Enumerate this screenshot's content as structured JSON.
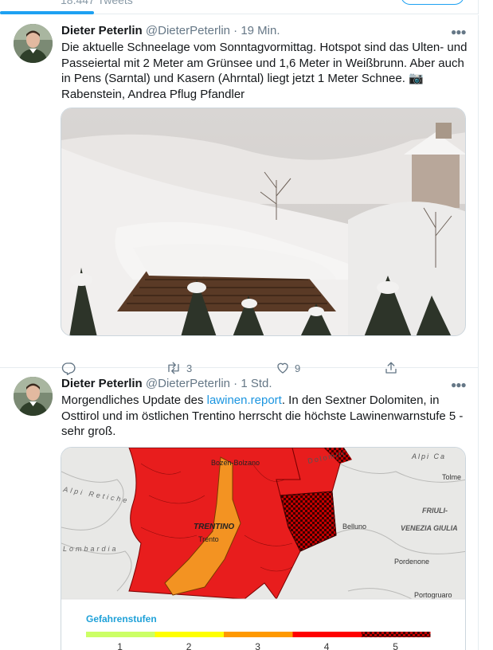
{
  "profile": {
    "tweet_count": "18.447 Tweets"
  },
  "tweets": [
    {
      "name": "Dieter Peterlin",
      "handle": "@DieterPeterlin",
      "time": "· 19 Min.",
      "text": "Die aktuelle Schneelage vom Sonntagvormittag. Hotspot sind das Ulten- und Passeiertal mit 2 Meter am Grünsee und 1,6 Meter in Weißbrunn. Aber auch in Pens (Sarntal) und Kasern (Ahrntal) liegt jetzt 1 Meter Schnee. 📷 Rabenstein, Andrea Pflug Pfandler",
      "more_icon": "more-horizontal-icon",
      "replies": "",
      "retweets": "3",
      "likes": "9",
      "icons": [
        "reply-icon",
        "retweet-icon",
        "like-icon",
        "share-icon"
      ]
    },
    {
      "name": "Dieter Peterlin",
      "handle": "@DieterPeterlin",
      "time": "· 1 Std.",
      "text_before": "Morgendliches Update des ",
      "link": "lawinen.report",
      "text_after": ". In den Sextner Dolomiten, in Osttirol und im östlichen Trentino herrscht die höchste Lawinenwarnstufe 5 - sehr groß.",
      "more_icon": "more-horizontal-icon",
      "map": {
        "labels": {
          "bozen": "Bozen-Bolzano",
          "trentino": "TRENTINO",
          "trento": "Trento",
          "belluno": "Belluno",
          "friuli": "FRIULI-",
          "venezia": "VENEZIA GIULIA",
          "pordenone": "Pordenone",
          "portogruaro": "Portogruaro",
          "tolmezzo": "Tolme",
          "dolomiti": "Dolomiti",
          "alpi_carniche": "Alpi Ca",
          "alpi_retiche": "Alpi Retiche",
          "lombardia": "Lombardia"
        },
        "legend_title": "Gefahrenstufen",
        "levels": [
          "1",
          "2",
          "3",
          "4",
          "5"
        ],
        "level_colors": [
          "#ccff66",
          "#ffff00",
          "#ff9900",
          "#ff0000",
          "#a00000"
        ]
      }
    }
  ],
  "colors": {
    "accent": "#1da1f2",
    "link": "#1b95e0",
    "secondary_text": "#657786",
    "border": "#e6ecf0"
  }
}
